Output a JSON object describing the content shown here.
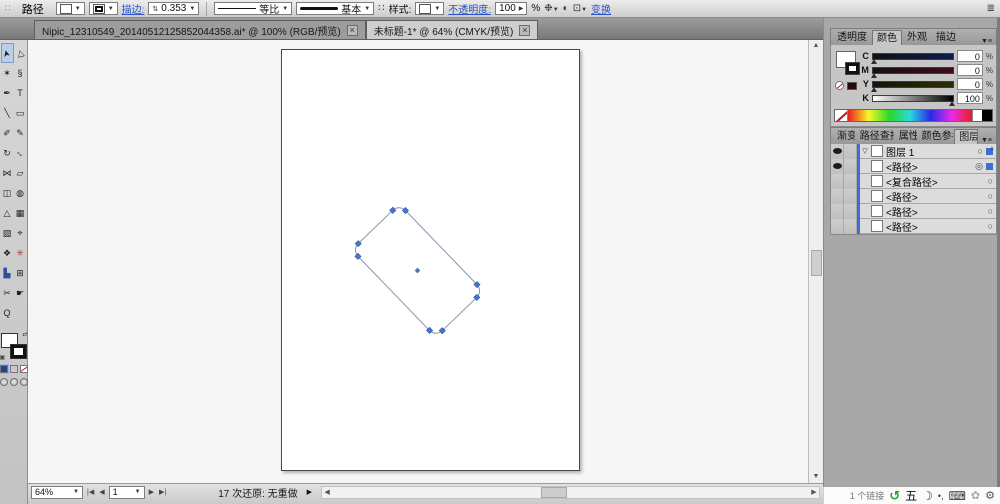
{
  "control_bar": {
    "selection_label": "路径",
    "stroke_label": "描边:",
    "stroke_weight": "0.353",
    "width_profile_label": "等比",
    "brush_label": "基本",
    "style_label": "样式:",
    "opacity_label": "不透明度:",
    "opacity_value": "100",
    "opacity_percent": "%",
    "transform_label": "变换"
  },
  "document_tabs": [
    {
      "title": "Nipic_12310549_20140512125852044358.ai* @ 100% (RGB/预览)",
      "close": "×",
      "active": false
    },
    {
      "title": "未标题-1* @ 64% (CMYK/预览)",
      "close": "×",
      "active": true
    }
  ],
  "tools": [
    {
      "name": "selection",
      "glyph": "➤",
      "rot": "rotneg100",
      "active": true
    },
    {
      "name": "direct-selection",
      "glyph": "▷",
      "rot": "rotneg100"
    },
    {
      "name": "magic-wand",
      "glyph": "✶"
    },
    {
      "name": "lasso",
      "glyph": "§"
    },
    {
      "name": "pen",
      "glyph": "✒"
    },
    {
      "name": "type",
      "glyph": "T"
    },
    {
      "name": "line-segment",
      "glyph": "╲"
    },
    {
      "name": "rectangle",
      "glyph": "▭"
    },
    {
      "name": "paintbrush",
      "glyph": "✐"
    },
    {
      "name": "pencil",
      "glyph": "✎"
    },
    {
      "name": "rotate",
      "glyph": "↻"
    },
    {
      "name": "scale",
      "glyph": "↔",
      "rot": "rot45"
    },
    {
      "name": "width",
      "glyph": "⋈"
    },
    {
      "name": "free-transform",
      "glyph": "▱"
    },
    {
      "name": "shape-builder",
      "glyph": "◫"
    },
    {
      "name": "live-paint-bucket",
      "glyph": "◍"
    },
    {
      "name": "perspective-grid",
      "glyph": "△"
    },
    {
      "name": "mesh",
      "glyph": "▦"
    },
    {
      "name": "gradient",
      "glyph": "▧"
    },
    {
      "name": "eyedropper",
      "glyph": "⌖"
    },
    {
      "name": "blend",
      "glyph": "❖"
    },
    {
      "name": "symbol-sprayer",
      "glyph": "✳",
      "color": "#b3393c"
    },
    {
      "name": "column-graph",
      "glyph": "▙",
      "color": "#2c4f9e"
    },
    {
      "name": "artboard",
      "glyph": "⊞"
    },
    {
      "name": "slice",
      "glyph": "✂"
    },
    {
      "name": "hand",
      "glyph": "☛"
    },
    {
      "name": "zoom",
      "glyph": "Q"
    },
    {
      "name": "",
      "glyph": ""
    }
  ],
  "color_panel": {
    "tabs": [
      {
        "label": "透明度",
        "active": false
      },
      {
        "label": "颜色",
        "active": true
      },
      {
        "label": "外观",
        "active": false
      },
      {
        "label": "描边",
        "active": false
      }
    ],
    "channels": [
      {
        "label": "C",
        "value": "0",
        "unit": "%"
      },
      {
        "label": "M",
        "value": "0",
        "unit": "%"
      },
      {
        "label": "Y",
        "value": "0",
        "unit": "%"
      },
      {
        "label": "K",
        "value": "100",
        "unit": "%"
      }
    ]
  },
  "layers_panel": {
    "tabs": [
      {
        "label": "渐变",
        "active": false
      },
      {
        "label": "路径查找器",
        "active": false
      },
      {
        "label": "属性",
        "active": false
      },
      {
        "label": "颜色参考",
        "active": false
      },
      {
        "label": "图层",
        "active": true
      }
    ],
    "rows": [
      {
        "name": "图层 1",
        "eye": true,
        "expand": true,
        "target": "○",
        "selected": true,
        "indent": 0
      },
      {
        "name": "<路径>",
        "eye": true,
        "expand": false,
        "target": "◎",
        "selected": true,
        "indent": 1
      },
      {
        "name": "<复合路径>",
        "eye": false,
        "expand": false,
        "target": "○",
        "selected": false,
        "indent": 1
      },
      {
        "name": "<路径>",
        "eye": false,
        "expand": false,
        "target": "○",
        "selected": false,
        "indent": 1
      },
      {
        "name": "<路径>",
        "eye": false,
        "expand": false,
        "target": "○",
        "selected": false,
        "indent": 1
      },
      {
        "name": "<路径>",
        "eye": false,
        "expand": false,
        "target": "○",
        "selected": false,
        "indent": 1
      }
    ]
  },
  "status_bar": {
    "zoom": "64%",
    "page": "1",
    "message": "17 次还原: 无重做"
  },
  "tray": {
    "text": "1 个链接",
    "ime_char": "五"
  },
  "colors": {
    "selection_blue": "#3f6fd0",
    "link_blue": "#2a52c8",
    "anchor_blue": "#4a74c8"
  }
}
